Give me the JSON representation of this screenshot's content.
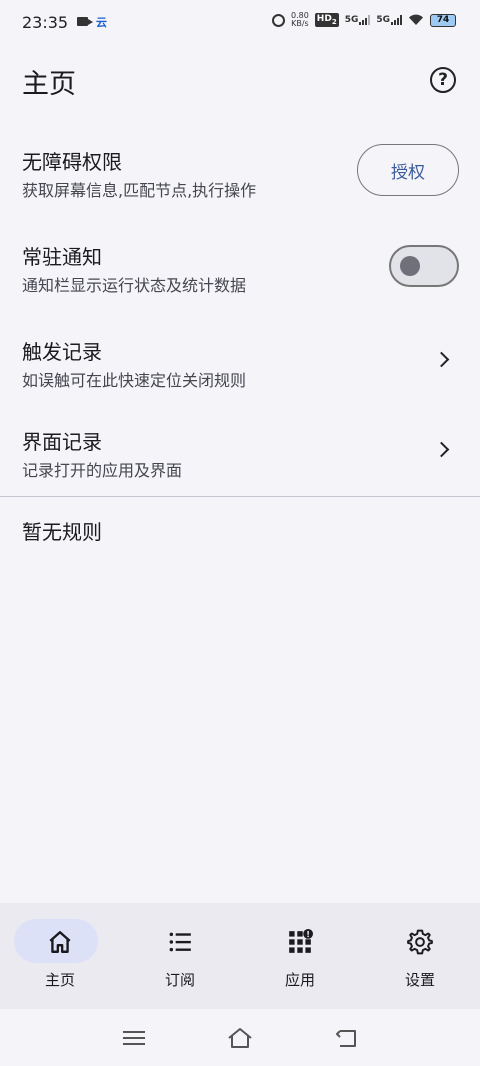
{
  "status_bar": {
    "time": "23:35",
    "app_badge": "云",
    "net_speed_value": "0.80",
    "net_speed_unit": "KB/s",
    "hd": "HD",
    "hd_sub": "2",
    "sig1": "5G",
    "sig2": "5G",
    "battery": "74"
  },
  "header": {
    "title": "主页",
    "help_symbol": "?"
  },
  "rows": [
    {
      "title": "无障碍权限",
      "subtitle": "获取屏幕信息,匹配节点,执行操作",
      "action_label": "授权"
    },
    {
      "title": "常驻通知",
      "subtitle": "通知栏显示运行状态及统计数据",
      "toggle_on": false
    },
    {
      "title": "触发记录",
      "subtitle": "如误触可在此快速定位关闭规则"
    },
    {
      "title": "界面记录",
      "subtitle": "记录打开的应用及界面"
    }
  ],
  "empty_text": "暂无规则",
  "bottom_nav": {
    "items": [
      {
        "label": "主页",
        "icon": "home-icon",
        "selected": true
      },
      {
        "label": "订阅",
        "icon": "list-icon",
        "selected": false
      },
      {
        "label": "应用",
        "icon": "apps-icon",
        "selected": false,
        "badge": "!"
      },
      {
        "label": "设置",
        "icon": "gear-icon",
        "selected": false
      }
    ]
  },
  "colors": {
    "background": "#f5f5f9",
    "nav_background": "#eaeaf0",
    "nav_selected_pill": "#dde1f7",
    "auth_text": "#3b5a9a"
  }
}
